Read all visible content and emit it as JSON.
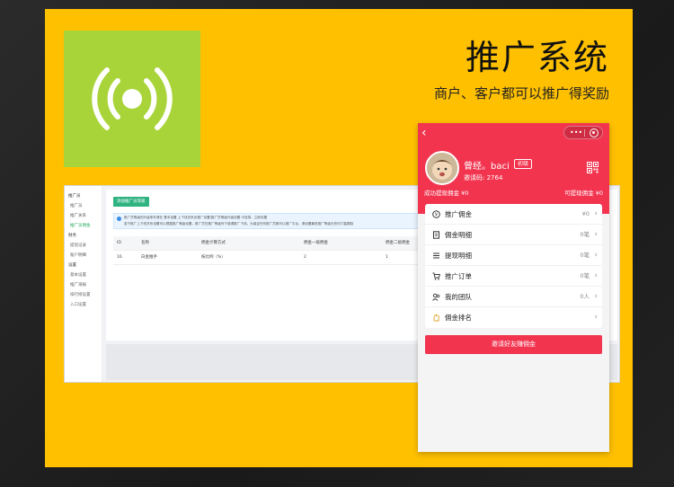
{
  "banner": {
    "headline": "推广系统",
    "subline": "商户、客户都可以推广得奖励"
  },
  "logo": {
    "icon": "broadcast-icon",
    "tile_color": "#a8d43a",
    "icon_color": "#ffffff"
  },
  "colors": {
    "frame_yellow": "#ffc000",
    "brand_red": "#f2344f",
    "admin_green": "#2fb380"
  },
  "admin": {
    "sidebar": [
      "推广员",
      "推广员",
      "推广关系",
      "推广员佣金",
      "财务",
      "提现记录",
      "账户明细",
      "设置",
      "基本设置",
      "推广海报",
      "排行榜设置",
      "入口设置"
    ],
    "sidebar_active_index": 3,
    "add_button": "添加推广员等级",
    "notice": {
      "line1": "推广员等级的升级条件请在 基本设置 上下线关系页推广设置/推广员等级升级设置 中选择。立即设置",
      "line2": "若于推广上下线关系设置可以根据推广等级设置，推广员在推广等级列下邀请推广下线，为保证任何推广员都可以推广平台，请设置最低推广等级无任何门槛限制"
    },
    "table": {
      "headers": [
        "ID",
        "名称",
        "佣金计算方式",
        "佣金一级佣金",
        "佣金二级佣金"
      ],
      "rows": [
        [
          "16",
          "白金推手",
          "按比例（%）",
          "2",
          "1"
        ]
      ]
    }
  },
  "phone": {
    "back_icon": "chevron-left-icon",
    "capsule_menu": "•••",
    "user": {
      "name": "曾经。baci",
      "level": "初级",
      "invite_code": "邀请码: 2764"
    },
    "stats": {
      "withdrawn": "成功提现佣金 ¥0",
      "withdrawable": "可提现佣金 ¥0"
    },
    "menu": [
      {
        "icon": "money-circle-icon",
        "label": "推广佣金",
        "value": "¥0"
      },
      {
        "icon": "document-icon",
        "label": "佣金明细",
        "value": "0笔"
      },
      {
        "icon": "list-icon",
        "label": "提现明细",
        "value": "0笔"
      },
      {
        "icon": "cart-icon",
        "label": "推广订单",
        "value": "0笔"
      },
      {
        "icon": "team-icon",
        "label": "我的团队",
        "value": "0人"
      },
      {
        "icon": "hand-icon",
        "label": "佣金排名",
        "value": ""
      }
    ],
    "cta": "邀请好友赚佣金"
  }
}
